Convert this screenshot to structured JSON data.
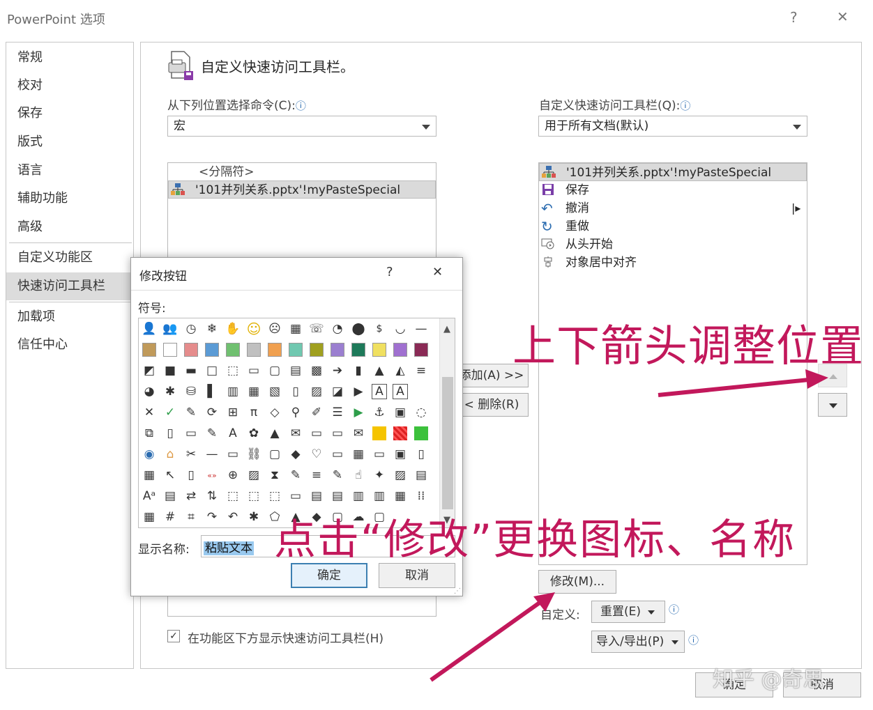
{
  "window": {
    "title": "PowerPoint 选项",
    "help": "?",
    "close": "✕"
  },
  "nav": {
    "items": [
      "常规",
      "校对",
      "保存",
      "版式",
      "语言",
      "辅助功能",
      "高级",
      "自定义功能区",
      "快速访问工具栏",
      "加载项",
      "信任中心"
    ]
  },
  "main": {
    "heading": "自定义快速访问工具栏。",
    "left_label": "从下列位置选择命令(C):",
    "left_select_value": "宏",
    "left_list": [
      "<分隔符>",
      "'101并列关系.pptx'!myPasteSpecial"
    ],
    "right_label": "自定义快速访问工具栏(Q):",
    "right_select_value": "用于所有文档(默认)",
    "right_list": [
      "'101并列关系.pptx'!myPasteSpecial",
      "保存",
      "撤消",
      "重做",
      "从头开始",
      "对象居中对齐"
    ],
    "add_button": "添加(A) >>",
    "remove_button": "< 删除(R)",
    "modify_button": "修改(M)...",
    "customize_label": "自定义:",
    "reset_button": "重置(E)",
    "import_export_button": "导入/导出(P)",
    "show_below_checkbox": "在功能区下方显示快速访问工具栏(H)",
    "ok_button": "确定",
    "cancel_button": "取消",
    "info_icon": "ⓘ"
  },
  "dialog": {
    "title": "修改按钮",
    "help": "?",
    "close": "✕",
    "symbol_label": "符号:",
    "display_name_label": "显示名称:",
    "display_name_value": "粘贴文本",
    "ok_button": "确定",
    "cancel_button": "取消"
  },
  "annotations": {
    "arrows_text": "上下箭头调整位置",
    "modify_text": "点击“修改”更换图标、名称",
    "color": "#c2185b"
  },
  "watermark": "知乎 @奇思"
}
